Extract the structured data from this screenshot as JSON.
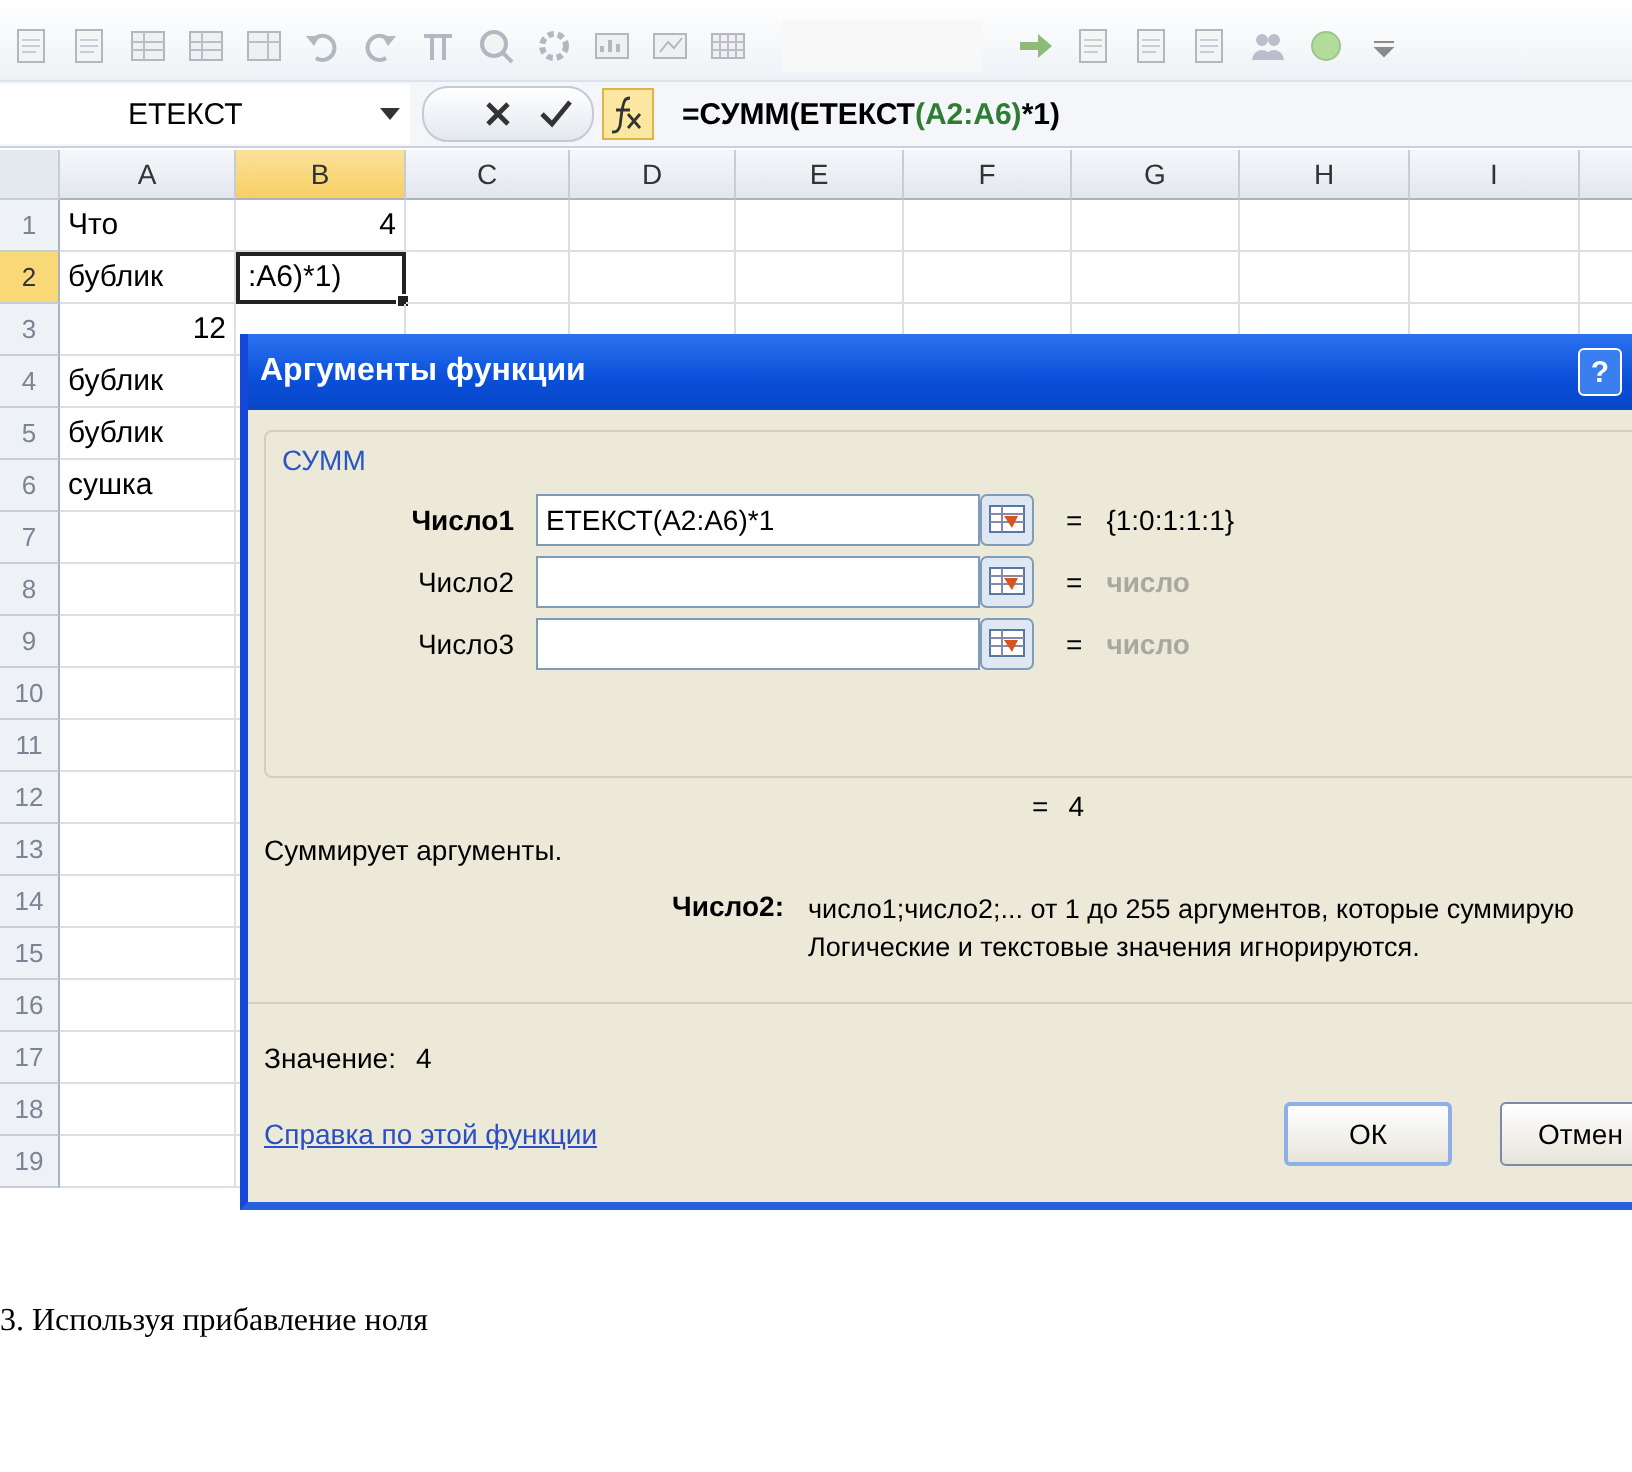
{
  "formula_bar": {
    "name_box": "ЕТЕКСТ",
    "formula_parts": [
      {
        "text": "=СУММ(ЕТЕКСТ",
        "color": "#000000"
      },
      {
        "text": "(A2:A6)",
        "color": "#2e7d32"
      },
      {
        "text": "*1)",
        "color": "#000000"
      }
    ]
  },
  "sheet": {
    "columns": [
      {
        "label": "A",
        "selected": false
      },
      {
        "label": "B",
        "selected": true
      },
      {
        "label": "C",
        "selected": false
      },
      {
        "label": "D",
        "selected": false
      },
      {
        "label": "E",
        "selected": false
      },
      {
        "label": "F",
        "selected": false
      },
      {
        "label": "G",
        "selected": false
      },
      {
        "label": "H",
        "selected": false
      },
      {
        "label": "I",
        "selected": false
      }
    ],
    "rows": [
      {
        "label": "1",
        "selected": false,
        "cells": [
          {
            "text": "Что",
            "kind": "text"
          },
          {
            "text": "4",
            "kind": "number"
          }
        ]
      },
      {
        "label": "2",
        "selected": true,
        "cells": [
          {
            "text": "бублик",
            "kind": "text"
          },
          {
            "text": ":A6)*1)",
            "kind": "text",
            "active": true
          }
        ]
      },
      {
        "label": "3",
        "selected": false,
        "cells": [
          {
            "text": "12",
            "kind": "number"
          }
        ]
      },
      {
        "label": "4",
        "selected": false,
        "cells": [
          {
            "text": "бублик",
            "kind": "text"
          }
        ]
      },
      {
        "label": "5",
        "selected": false,
        "cells": [
          {
            "text": "бублик",
            "kind": "text"
          }
        ]
      },
      {
        "label": "6",
        "selected": false,
        "cells": [
          {
            "text": "сушка",
            "kind": "text"
          }
        ]
      },
      {
        "label": "7",
        "selected": false
      },
      {
        "label": "8",
        "selected": false
      },
      {
        "label": "9",
        "selected": false
      },
      {
        "label": "10",
        "selected": false
      },
      {
        "label": "11",
        "selected": false
      },
      {
        "label": "12",
        "selected": false
      },
      {
        "label": "13",
        "selected": false
      },
      {
        "label": "14",
        "selected": false
      },
      {
        "label": "15",
        "selected": false
      },
      {
        "label": "16",
        "selected": false
      },
      {
        "label": "17",
        "selected": false
      },
      {
        "label": "18",
        "selected": false
      },
      {
        "label": "19",
        "selected": false
      }
    ]
  },
  "dialog": {
    "title": "Аргументы функции",
    "help_button": "?",
    "function_name": "СУММ",
    "arguments": [
      {
        "label": "Число1",
        "required": true,
        "value": "ЕТЕКСТ(A2:A6)*1",
        "equals": "=",
        "result": "{1:0:1:1:1}",
        "result_is_hint": false
      },
      {
        "label": "Число2",
        "required": false,
        "equals": "=",
        "result": "число",
        "result_is_hint": true
      },
      {
        "label": "Число3",
        "required": false,
        "equals": "=",
        "result": "число",
        "result_is_hint": true
      }
    ],
    "total_equals": "=",
    "total": "4",
    "description": "Суммирует аргументы.",
    "argument_help": {
      "label": "Число2:",
      "lines": [
        "число1;число2;... от 1 до 255 аргументов, которые суммирую",
        "Логические и текстовые значения игнорируются."
      ]
    },
    "value_label": "Значение:",
    "value": "4",
    "help_link": "Справка по этой функции",
    "buttons": [
      {
        "label": "ОК",
        "default": true
      },
      {
        "label": "Отмен",
        "default": false
      }
    ]
  },
  "caption": "3. Используя прибавление ноля"
}
